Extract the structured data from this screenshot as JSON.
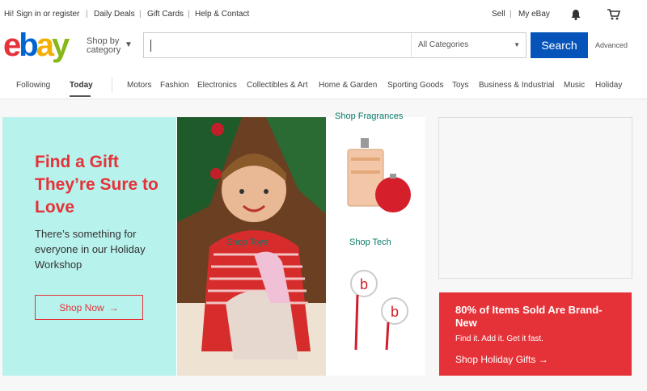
{
  "topbar": {
    "signin": "Hi! Sign in or register",
    "daily_deals": "Daily Deals",
    "gift_cards": "Gift Cards",
    "help": "Help & Contact",
    "sell": "Sell",
    "my_ebay": "My eBay",
    "bell_icon": "bell-icon",
    "cart_icon": "cart-icon"
  },
  "header": {
    "logo": {
      "e": "e",
      "b": "b",
      "a": "a",
      "y": "y"
    },
    "shop_by": "Shop by category",
    "search_placeholder": "",
    "category": "All Categories",
    "search_button": "Search",
    "advanced": "Advanced"
  },
  "nav": {
    "following": "Following",
    "today": "Today",
    "items": [
      "Motors",
      "Fashion",
      "Electronics",
      "Collectibles & Art",
      "Home & Garden",
      "Sporting Goods",
      "Toys",
      "Business & Industrial",
      "Music",
      "Holiday"
    ]
  },
  "hero": {
    "title": "Find a Gift They’re Sure to Love",
    "subtitle": "There’s something for everyone in our Holiday Workshop",
    "cta": "Shop Now",
    "toys": "Shop Toys",
    "fragrances": "Shop Fragrances",
    "tech": "Shop Tech"
  },
  "promo": {
    "title": "80% of Items Sold Are Brand-New",
    "subtitle": "Find it. Add it. Get it fast.",
    "link": "Shop Holiday Gifts"
  },
  "colors": {
    "brand_red": "#e53238",
    "brand_blue": "#0064d2",
    "search_blue": "#0654ba",
    "mint": "#b8f2ec"
  }
}
